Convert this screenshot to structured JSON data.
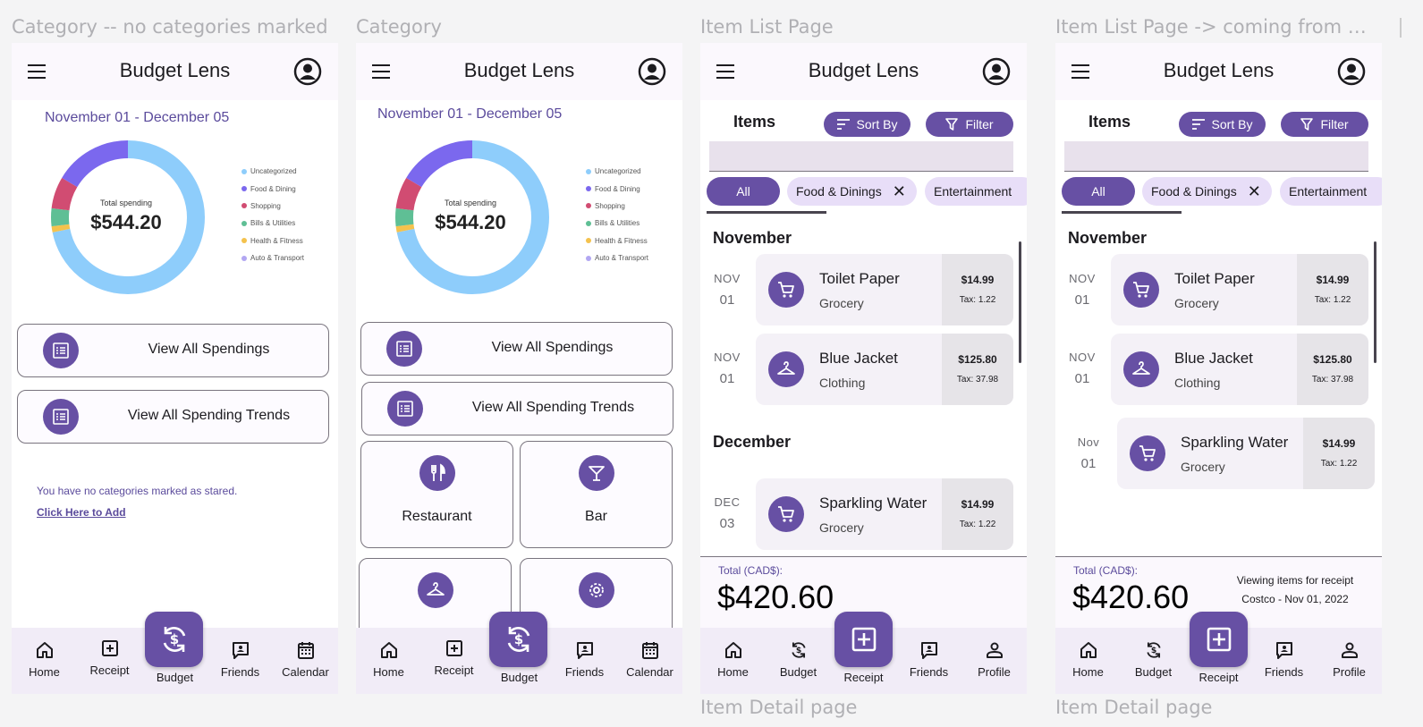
{
  "frames": [
    {
      "frame_label": "Category -- no categories marked",
      "app_title": "Budget Lens",
      "date_range": "November 01 - December 05",
      "donut": {
        "center_label": "Total spending",
        "center_value": "$544.20"
      },
      "legend": [
        "Uncategorized",
        "Food & Dining",
        "Shopping",
        "Bills & Utilities",
        "Health & Fitness",
        "Auto & Transport"
      ],
      "buttons": [
        "View All Spendings",
        "View All Spending Trends"
      ],
      "empty_message": "You have no categories marked as stared.",
      "empty_link": "Click Here to Add",
      "nav": [
        "Home",
        "Receipt",
        "Budget",
        "Friends",
        "Calendar"
      ]
    },
    {
      "frame_label": "Category",
      "app_title": "Budget Lens",
      "date_range": "November 01 - December 05",
      "donut": {
        "center_label": "Total spending",
        "center_value": "$544.20"
      },
      "legend": [
        "Uncategorized",
        "Food & Dining",
        "Shopping",
        "Bills & Utilities",
        "Health & Fitness",
        "Auto & Transport"
      ],
      "buttons": [
        "View All Spendings",
        "View All Spending Trends"
      ],
      "categories": [
        "Restaurant",
        "Bar"
      ],
      "nav": [
        "Home",
        "Receipt",
        "Budget",
        "Friends",
        "Calendar"
      ]
    },
    {
      "frame_label": "Item List Page",
      "bottom_label": "Item Detail page",
      "app_title": "Budget Lens",
      "items_heading": "Items",
      "sort_label": "Sort By",
      "filter_label": "Filter",
      "chips": [
        "All",
        "Food & Dinings",
        "Entertainment"
      ],
      "months": [
        "November",
        "December"
      ],
      "entries": [
        {
          "month_abbr": "NOV",
          "day": "01",
          "name": "Toilet Paper",
          "category": "Grocery",
          "price": "$14.99",
          "tax": "Tax: 1.22"
        },
        {
          "month_abbr": "NOV",
          "day": "01",
          "name": "Blue Jacket",
          "category": "Clothing",
          "price": "$125.80",
          "tax": "Tax: 37.98"
        },
        {
          "month_abbr": "DEC",
          "day": "03",
          "name": "Sparkling Water",
          "category": "Grocery",
          "price": "$14.99",
          "tax": "Tax: 1.22"
        }
      ],
      "total_label": "Total (CAD$):",
      "total_value": "$420.60",
      "nav": [
        "Home",
        "Budget",
        "Receipt",
        "Friends",
        "Profile"
      ]
    },
    {
      "frame_label": "Item List Page -> coming from si...",
      "bottom_label": "Item Detail page",
      "app_title": "Budget Lens",
      "items_heading": "Items",
      "sort_label": "Sort By",
      "filter_label": "Filter",
      "chips": [
        "All",
        "Food & Dinings",
        "Entertainment"
      ],
      "months": [
        "November"
      ],
      "entries": [
        {
          "month_abbr": "NOV",
          "day": "01",
          "name": "Toilet Paper",
          "category": "Grocery",
          "price": "$14.99",
          "tax": "Tax: 1.22"
        },
        {
          "month_abbr": "NOV",
          "day": "01",
          "name": "Blue Jacket",
          "category": "Clothing",
          "price": "$125.80",
          "tax": "Tax: 37.98"
        },
        {
          "month_abbr": "Nov",
          "day": "01",
          "name": "Sparkling Water",
          "category": "Grocery",
          "price": "$14.99",
          "tax": "Tax: 1.22"
        }
      ],
      "total_label": "Total (CAD$):",
      "total_value": "$420.60",
      "receipt_note_1": "Viewing items for receipt",
      "receipt_note_2": "Costco - Nov 01, 2022",
      "nav": [
        "Home",
        "Budget",
        "Receipt",
        "Friends",
        "Profile"
      ]
    }
  ],
  "colors": {
    "primary": "#6750a4",
    "uncategorized": "#8ecdfb",
    "food_dining": "#7b68ee",
    "shopping": "#d14c72",
    "bills_utilities": "#5fbf95",
    "health_fitness": "#f4c24d",
    "auto_transport": "#b2a7f2"
  },
  "icons": [
    "menu-icon",
    "account-circle-icon",
    "receipt-list-icon",
    "home-icon",
    "add-box-icon",
    "currency-exchange-icon",
    "chat-icon",
    "calendar-icon",
    "cart-icon",
    "hanger-icon",
    "restaurant-icon",
    "cocktail-icon",
    "settings-icon",
    "sort-icon",
    "filter-icon",
    "close-icon",
    "person-icon"
  ]
}
